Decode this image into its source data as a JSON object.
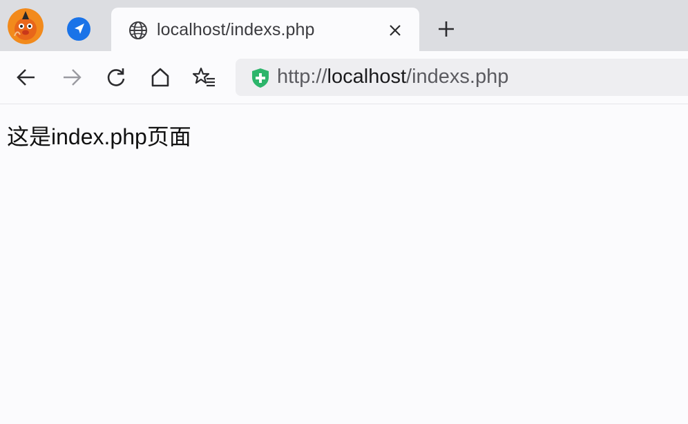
{
  "tabs": {
    "active": {
      "title": "localhost/indexs.php",
      "icon": "globe-icon"
    },
    "pinned": [
      {
        "icon": "navigation-arrow-icon",
        "color": "#1a73e8"
      }
    ],
    "profile": {
      "icon": "fox-avatar-icon",
      "color": "#f28a1c"
    },
    "new_tab_icon": "plus-icon"
  },
  "toolbar": {
    "back_icon": "back-arrow-icon",
    "forward_icon": "forward-arrow-icon",
    "reload_icon": "reload-icon",
    "home_icon": "home-icon",
    "favorites_icon": "star-list-icon"
  },
  "address_bar": {
    "scheme": "http://",
    "host": "localhost",
    "path": "/indexs.php",
    "security_icon": "shield-plus-icon",
    "security_color": "#2db56b"
  },
  "page": {
    "text": "这是index.php页面"
  },
  "colors": {
    "tab_strip_bg": "#dcdde1",
    "page_bg": "#fbfbfd",
    "address_bg": "#eeeef1"
  }
}
